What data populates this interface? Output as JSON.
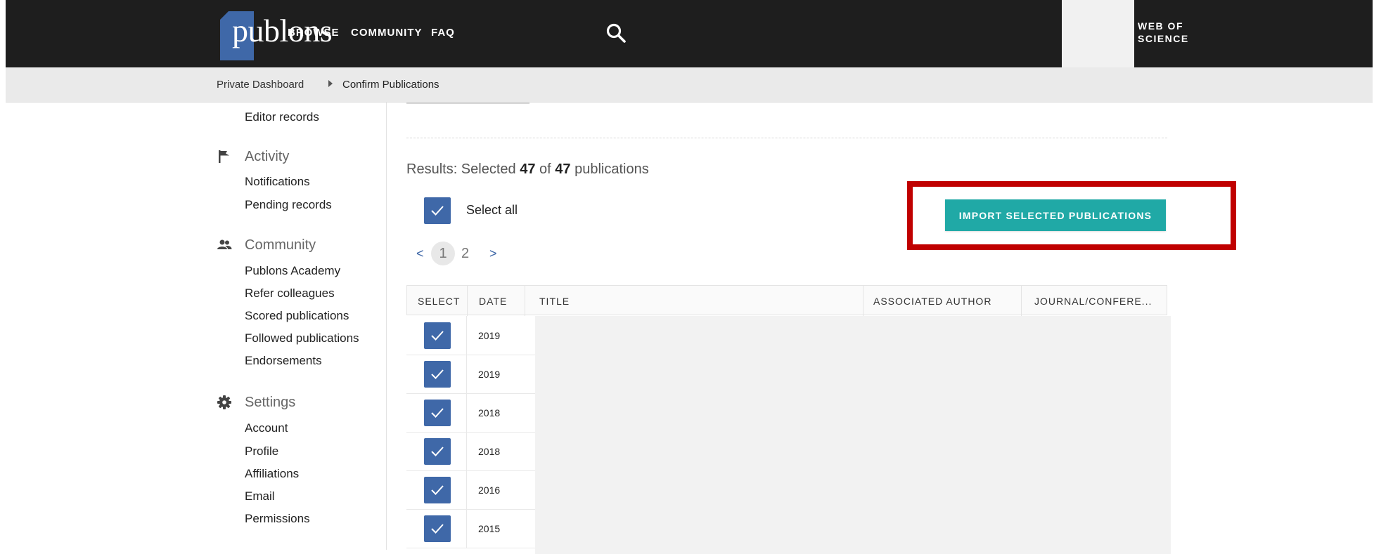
{
  "header": {
    "logo_text": "publons",
    "nav": [
      {
        "label": "BROWSE"
      },
      {
        "label": "COMMUNITY"
      },
      {
        "label": "FAQ"
      }
    ],
    "search_icon": "search-icon",
    "right_label_line1": "WEB OF",
    "right_label_line2": "SCIENCE",
    "bg_color": "#1e1e1e",
    "logo_color": "#3f68a8"
  },
  "breadcrumb": {
    "items": [
      "Private Dashboard",
      "Confirm Publications"
    ]
  },
  "sidebar": {
    "top_item": "Editor records",
    "sections": [
      {
        "heading": "Activity",
        "icon": "flag-icon",
        "items": [
          "Notifications",
          "Pending records"
        ]
      },
      {
        "heading": "Community",
        "icon": "people-icon",
        "items": [
          "Publons Academy",
          "Refer colleagues",
          "Scored publications",
          "Followed publications",
          "Endorsements"
        ]
      },
      {
        "heading": "Settings",
        "icon": "gear-icon",
        "items": [
          "Account",
          "Profile",
          "Affiliations",
          "Email",
          "Permissions"
        ]
      }
    ]
  },
  "main": {
    "results": {
      "prefix": "Results: Selected",
      "selected": "47",
      "of": "of",
      "total": "47",
      "suffix": "publications"
    },
    "select_all_label": "Select all",
    "import_button_label": "IMPORT SELECTED PUBLICATIONS",
    "import_button_color": "#20a9a6",
    "highlight_color": "#c00000",
    "pagination": {
      "prev": "<",
      "current": "1",
      "next_page": "2",
      "next": ">"
    },
    "table": {
      "columns": [
        "SELECT",
        "DATE",
        "TITLE",
        "ASSOCIATED AUTHOR",
        "JOURNAL/CONFERE..."
      ],
      "rows": [
        {
          "date": "2019",
          "checked": true
        },
        {
          "date": "2019",
          "checked": true
        },
        {
          "date": "2018",
          "checked": true
        },
        {
          "date": "2018",
          "checked": true
        },
        {
          "date": "2016",
          "checked": true
        },
        {
          "date": "2015",
          "checked": true
        }
      ]
    },
    "checkbox_color": "#3f68a8"
  }
}
